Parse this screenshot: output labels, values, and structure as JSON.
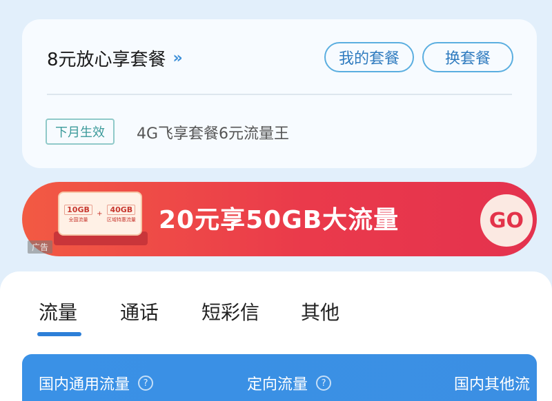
{
  "plan": {
    "current_name": "8元放心享套餐",
    "chevron": "»",
    "my_plan_label": "我的套餐",
    "change_plan_label": "换套餐",
    "next_badge": "下月生效",
    "next_plan_name": "4G飞享套餐6元流量王"
  },
  "banner": {
    "coupon_a_big": "10GB",
    "coupon_a_small": "全国流量",
    "coupon_plus": "+",
    "coupon_b_big": "40GB",
    "coupon_b_small": "区域特惠流量",
    "text": "20元享50GB大流量",
    "go_label": "GO",
    "ad_label": "广告"
  },
  "tabs": [
    {
      "label": "流量",
      "active": true
    },
    {
      "label": "通话",
      "active": false
    },
    {
      "label": "短彩信",
      "active": false
    },
    {
      "label": "其他",
      "active": false
    }
  ],
  "usage": {
    "col1": "国内通用流量",
    "col2": "定向流量",
    "col3": "国内其他流",
    "help_icon": "question-circle-icon"
  },
  "colors": {
    "background": "#e2effb",
    "accent": "#2d7fd8",
    "banner_red": "#ea3a4b",
    "panel_blue": "#3a91e6"
  }
}
